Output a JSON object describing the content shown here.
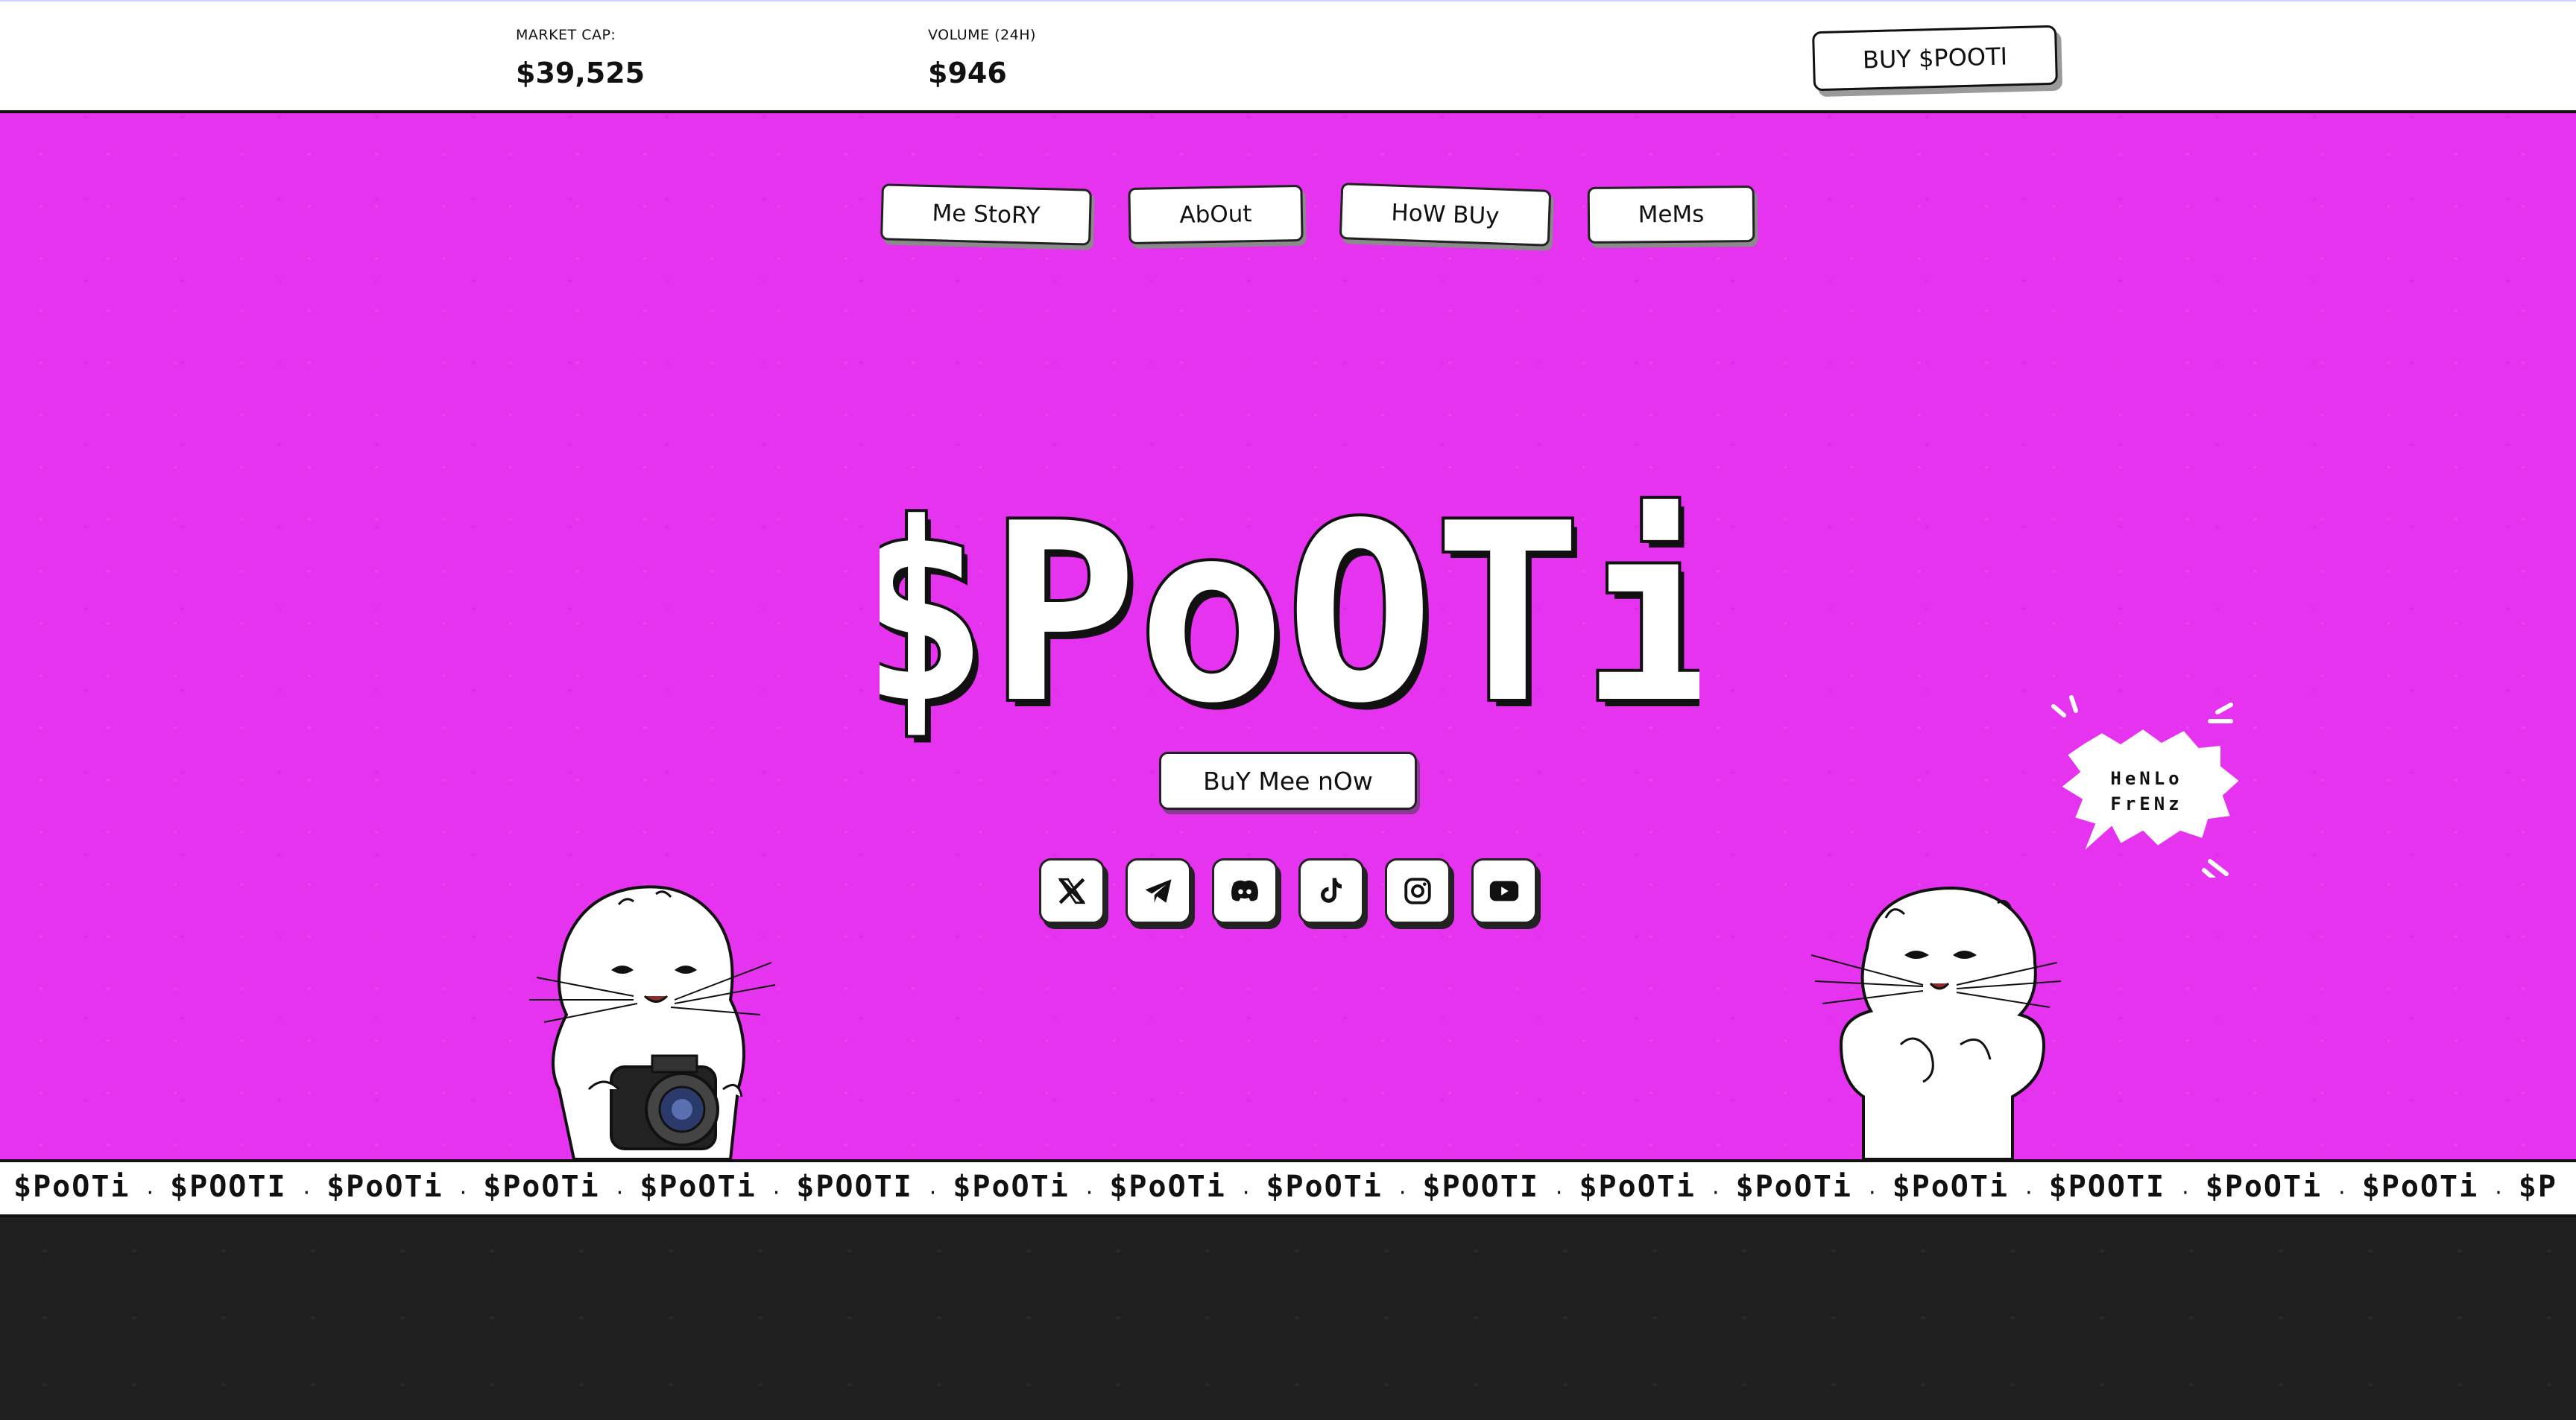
{
  "topbar": {
    "market_cap_label": "MARKET CAP:",
    "market_cap_value": "$39,525",
    "volume_label": "VOLUME (24H)",
    "volume_value": "$946",
    "buy_label": "BUY $POOTI"
  },
  "nav": [
    {
      "label": "Me StoRY"
    },
    {
      "label": "AbOut"
    },
    {
      "label": "HoW BUy"
    },
    {
      "label": "MeMs"
    }
  ],
  "hero": {
    "logo_text": "$PoOTi",
    "buy_label": "BuY Mee nOw",
    "speech_line1": "HeNLo",
    "speech_line2": "FrENz"
  },
  "socials": [
    {
      "icon": "x-twitter-icon"
    },
    {
      "icon": "telegram-icon"
    },
    {
      "icon": "discord-icon"
    },
    {
      "icon": "tiktok-icon"
    },
    {
      "icon": "instagram-icon"
    },
    {
      "icon": "youtube-icon"
    }
  ],
  "ticker": [
    "$PoOTi",
    "$POOTI",
    "$PoOTi",
    "$PoOTi",
    "$PoOTi",
    "$POOTI",
    "$PoOTi",
    "$PoOTi",
    "$PoOTi",
    "$POOTI",
    "$PoOTi",
    "$PoOTi",
    "$PoOTi",
    "$POOTI",
    "$PoOTi",
    "$PoOTi",
    "$P"
  ],
  "colors": {
    "hero_bg": "#e633ef",
    "bottom_bg": "#1f1f1f",
    "text": "#111111"
  }
}
